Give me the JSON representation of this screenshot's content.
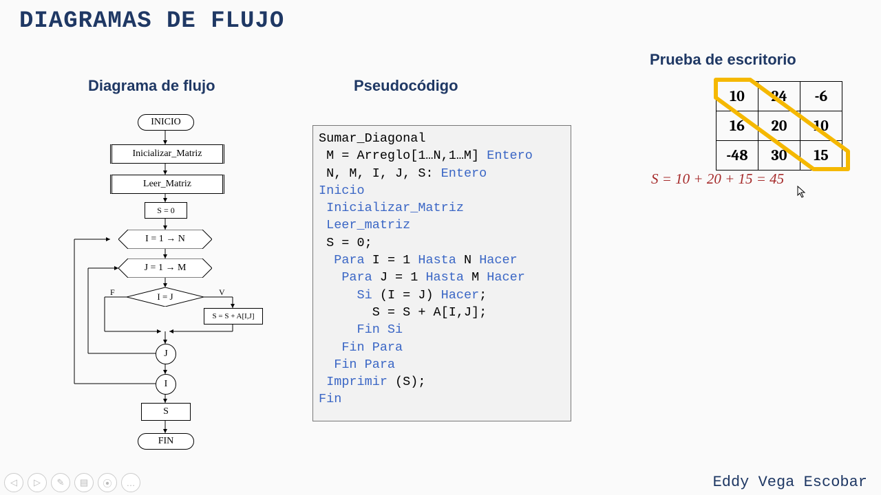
{
  "main_title": "DIAGRAMAS DE FLUJO",
  "columns": {
    "flow_title": "Diagrama de flujo",
    "pseudo_title": "Pseudocódigo",
    "desk_title": "Prueba de escritorio"
  },
  "flow": {
    "inicio": "INICIO",
    "init_matrix": "Inicializar_Matriz",
    "read_matrix": "Leer_Matriz",
    "s0": "S = 0",
    "loop_i": "I = 1 → N",
    "loop_j": "J = 1 → M",
    "decision": "I = J",
    "f": "F",
    "v": "V",
    "assign": "S = S + A[I,J]",
    "j": "J",
    "i": "I",
    "s": "S",
    "fin": "FIN"
  },
  "pseudo": {
    "l1": "Sumar_Diagonal",
    "l2a": " M = Arreglo[1…N,1…M] ",
    "l2b": "Entero",
    "l3a": " N, M, I, J, S: ",
    "l3b": "Entero",
    "l4": "Inicio",
    "l5": " Inicializar_Matriz",
    "l6": " Leer_matriz",
    "l7": " S = 0;",
    "l8a": "  ",
    "l8b": "Para",
    "l8c": " I = 1 ",
    "l8d": "Hasta",
    "l8e": " N ",
    "l8f": "Hacer",
    "l9a": "   ",
    "l9b": "Para",
    "l9c": " J = 1 ",
    "l9d": "Hasta",
    "l9e": " M ",
    "l9f": "Hacer",
    "l10a": "     ",
    "l10b": "Si",
    "l10c": " (I = J) ",
    "l10d": "Hacer",
    "l10e": ";",
    "l11": "       S = S + A[I,J];",
    "l12a": "     ",
    "l12b": "Fin Si",
    "l13a": "   ",
    "l13b": "Fin Para",
    "l14a": "  ",
    "l14b": "Fin Para",
    "l15a": " ",
    "l15b": "Imprimir",
    "l15c": " (S);",
    "l16": "Fin"
  },
  "desk": {
    "matrix": [
      [
        "10",
        "24",
        "-6"
      ],
      [
        "16",
        "20",
        "10"
      ],
      [
        "-48",
        "30",
        "15"
      ]
    ],
    "sum": "S = 10 + 20 + 15 = 45"
  },
  "author": "Eddy Vega Escobar",
  "icons": {
    "prev": "◁",
    "play": "▷",
    "pen": "✎",
    "slides": "▤",
    "zoom": "⦿",
    "more": "…"
  }
}
